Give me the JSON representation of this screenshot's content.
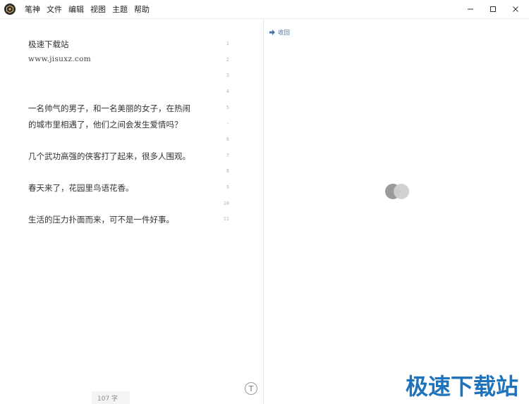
{
  "menu": {
    "items": [
      "笔神",
      "文件",
      "编辑",
      "视图",
      "主题",
      "帮助"
    ]
  },
  "window_controls": {
    "minimize": "—",
    "maximize": "☐",
    "close": "✕"
  },
  "editor": {
    "lines": [
      {
        "num": "1",
        "text": "极速下载站"
      },
      {
        "num": "2",
        "text": "www.jisuxz.com"
      },
      {
        "num": "3",
        "text": ""
      },
      {
        "num": "4",
        "text": ""
      },
      {
        "num": "5",
        "text": "一名帅气的男子，和一名美丽的女子，在热闹"
      },
      {
        "num": "-",
        "text": "的城市里相遇了，他们之间会发生爱情吗？"
      },
      {
        "num": "6",
        "text": ""
      },
      {
        "num": "7",
        "text": "几个武功高强的侠客打了起来，很多人围观。"
      },
      {
        "num": "8",
        "text": ""
      },
      {
        "num": "9",
        "text": "春天来了，花园里鸟语花香。"
      },
      {
        "num": "10",
        "text": ""
      },
      {
        "num": "11",
        "text": "生活的压力扑面而来，可不是一件好事。"
      }
    ],
    "word_count": "107 字",
    "typewriter_icon": "T"
  },
  "preview": {
    "collapse_label": "收回"
  },
  "watermark": "极速下载站",
  "colors": {
    "accent": "#4a74a8",
    "watermark": "#1f73bd"
  }
}
